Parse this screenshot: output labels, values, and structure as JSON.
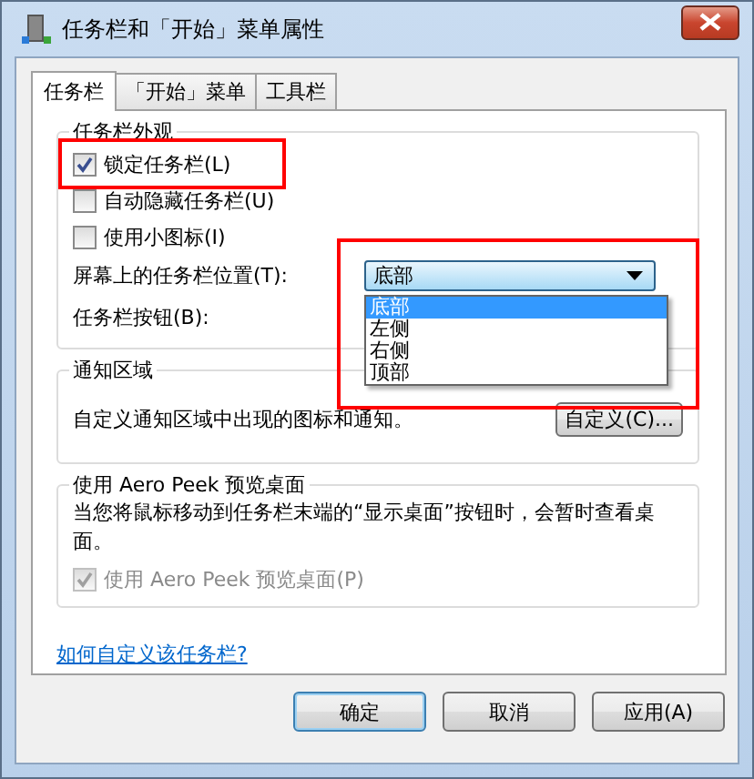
{
  "window": {
    "title": "任务栏和「开始」菜单属性"
  },
  "tabs": [
    {
      "label": "任务栏",
      "selected": true
    },
    {
      "label": "「开始」菜单",
      "selected": false
    },
    {
      "label": "工具栏",
      "selected": false
    }
  ],
  "appearance": {
    "title": "任务栏外观",
    "checkboxes": [
      {
        "label": "锁定任务栏(L)",
        "checked": true
      },
      {
        "label": "自动隐藏任务栏(U)",
        "checked": false
      },
      {
        "label": "使用小图标(I)",
        "checked": false
      }
    ],
    "position": {
      "label": "屏幕上的任务栏位置(T):",
      "value": "底部",
      "expanded": true,
      "options": [
        {
          "label": "底部",
          "selected": true
        },
        {
          "label": "左侧",
          "selected": false
        },
        {
          "label": "右侧",
          "selected": false
        },
        {
          "label": "顶部",
          "selected": false
        }
      ]
    },
    "buttons_label": "任务栏按钮(B):"
  },
  "notification": {
    "title": "通知区域",
    "text": "自定义通知区域中出现的图标和通知。",
    "button": "自定义(C)..."
  },
  "aero_peek": {
    "title": "使用 Aero Peek 预览桌面",
    "text": "当您将鼠标移动到任务栏末端的“显示桌面”按钮时，会暂时查看桌面。",
    "checkbox": {
      "label": "使用 Aero Peek 预览桌面(P)",
      "checked": true,
      "disabled": true
    }
  },
  "help_link": "如何自定义该任务栏?",
  "buttons": [
    {
      "label": "确定",
      "default": true
    },
    {
      "label": "取消",
      "default": false
    },
    {
      "label": "应用(A)",
      "default": false
    }
  ]
}
